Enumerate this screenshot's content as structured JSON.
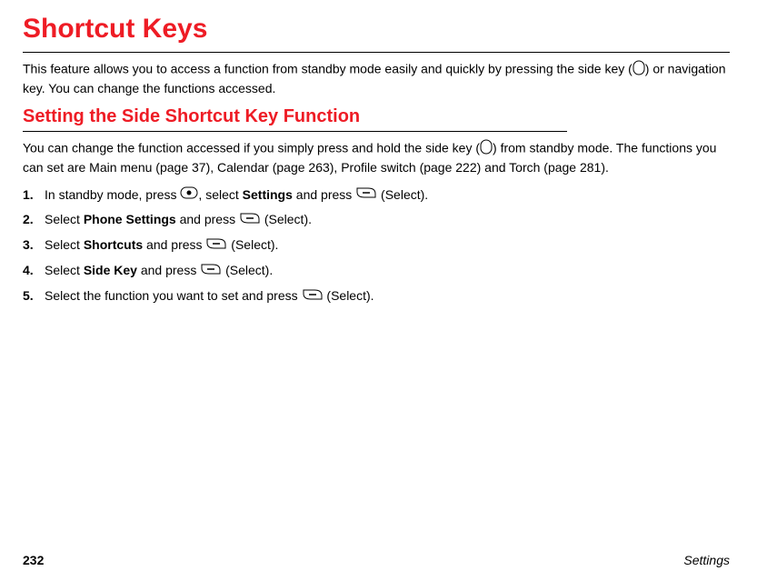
{
  "page": {
    "title": "Shortcut Keys",
    "intro_part1": "This feature allows you to access a function from standby mode easily and quickly by pressing the side key (",
    "intro_part2": ") or navigation key. You can change the functions accessed.",
    "section": {
      "title": "Setting the Side Shortcut Key Function",
      "body_part1": "You can change the function accessed if you simply press and hold the side key (",
      "body_part2": ") from standby mode. The functions you can set are Main menu (page 37), Calendar (page 263), Profile switch (page 222) and Torch (page 281).",
      "steps": [
        {
          "num": "1.",
          "pre": "In standby mode, press ",
          "seg1": ", select ",
          "bold1": "Settings",
          "seg2": " and press ",
          "tail": " (Select)."
        },
        {
          "num": "2.",
          "pre": "Select ",
          "bold1": "Phone Settings",
          "seg2": " and press ",
          "tail": " (Select)."
        },
        {
          "num": "3.",
          "pre": "Select ",
          "bold1": "Shortcuts",
          "seg2": " and press ",
          "tail": " (Select)."
        },
        {
          "num": "4.",
          "pre": "Select ",
          "bold1": "Side Key",
          "seg2": " and press ",
          "tail": " (Select)."
        },
        {
          "num": "5.",
          "pre": "Select the function you want to set and press ",
          "tail": " (Select)."
        }
      ]
    },
    "footer": {
      "page_number": "232",
      "section_name": "Settings"
    }
  }
}
